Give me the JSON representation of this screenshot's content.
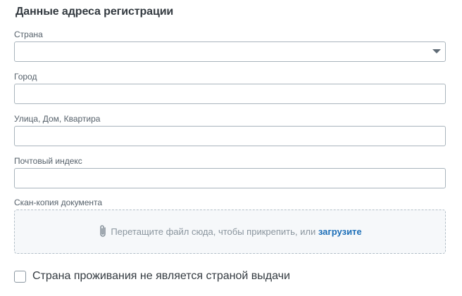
{
  "section": {
    "title": "Данные адреса регистрации"
  },
  "fields": {
    "country": {
      "label": "Страна",
      "value": ""
    },
    "city": {
      "label": "Город",
      "value": "",
      "placeholder": ""
    },
    "street": {
      "label": "Улица, Дом, Квартира",
      "value": "",
      "placeholder": ""
    },
    "postal": {
      "label": "Почтовый индекс",
      "value": "",
      "placeholder": ""
    }
  },
  "upload": {
    "label": "Скан-копия документа",
    "hint": "Перетащите файл сюда, чтобы прикрепить, или",
    "link": "загрузите",
    "icon": "paperclip-icon"
  },
  "checkbox": {
    "label": "Страна проживания не является страной выдачи",
    "checked": false
  },
  "colors": {
    "title": "#333a40",
    "border": "#a9b4bc",
    "link": "#1d6fb8",
    "dropzone_bg": "#f6f8fa"
  }
}
